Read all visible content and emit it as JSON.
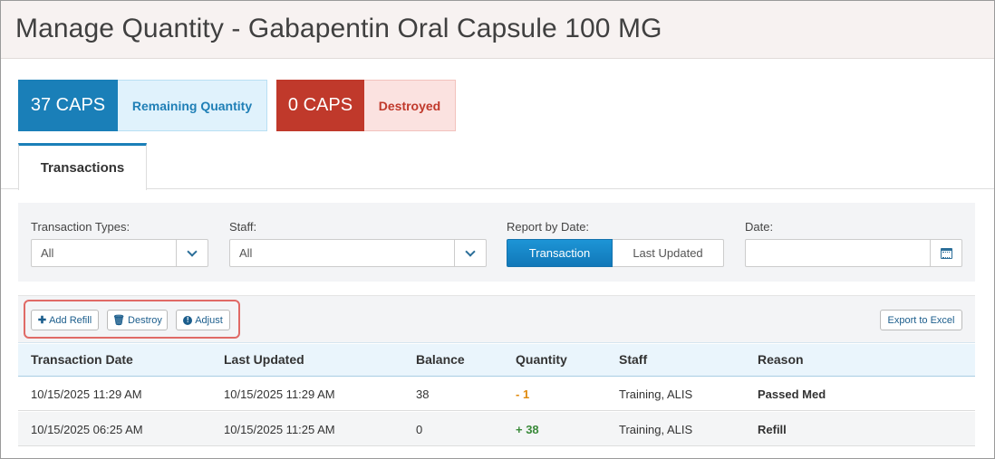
{
  "page_title": "Manage Quantity - Gabapentin Oral Capsule 100 MG",
  "stats": {
    "remaining": {
      "value": "37 CAPS",
      "label": "Remaining Quantity",
      "color": "#1a7fb8"
    },
    "destroyed": {
      "value": "0 CAPS",
      "label": "Destroyed",
      "color": "#c0392b"
    }
  },
  "tabs": [
    {
      "label": "Transactions",
      "active": true
    }
  ],
  "filters": {
    "transaction_types": {
      "label": "Transaction Types:",
      "value": "All",
      "icon": "chevron-down-icon"
    },
    "staff": {
      "label": "Staff:",
      "value": "All",
      "icon": "chevron-down-icon"
    },
    "report_by_date": {
      "label": "Report by Date:",
      "options": [
        "Transaction",
        "Last Updated"
      ],
      "selected": "Transaction"
    },
    "date": {
      "label": "Date:",
      "value": "",
      "icon": "calendar-icon"
    }
  },
  "toolbar": {
    "add_refill": {
      "label": "Add Refill",
      "icon": "plus-icon"
    },
    "destroy": {
      "label": "Destroy",
      "icon": "trash-icon"
    },
    "adjust": {
      "label": "Adjust",
      "icon": "exclamation-circle-icon"
    },
    "export": {
      "label": "Export to Excel"
    }
  },
  "table": {
    "columns": [
      "Transaction Date",
      "Last Updated",
      "Balance",
      "Quantity",
      "Staff",
      "Reason"
    ],
    "rows": [
      {
        "transaction_date": "10/15/2025 11:29 AM",
        "last_updated": "10/15/2025 11:29 AM",
        "balance": "38",
        "quantity": "- 1",
        "staff": "Training, ALIS",
        "reason": "Passed Med"
      },
      {
        "transaction_date": "10/15/2025 06:25 AM",
        "last_updated": "10/15/2025 11:25 AM",
        "balance": "0",
        "quantity": "+ 38",
        "staff": "Training, ALIS",
        "reason": "Refill"
      }
    ]
  }
}
